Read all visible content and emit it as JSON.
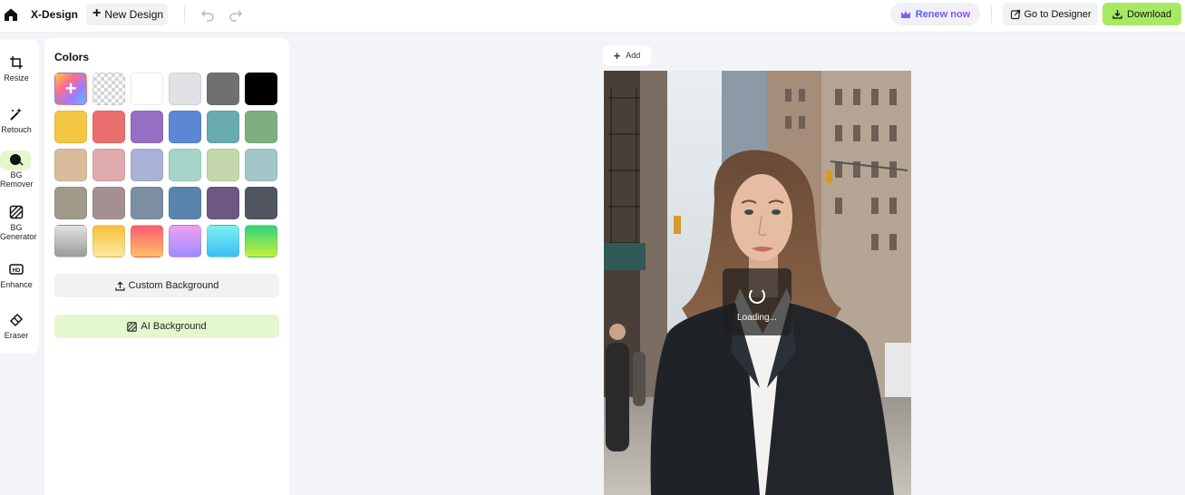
{
  "header": {
    "brand": "X-Design",
    "new_design_label": "New Design",
    "renew_label": "Renew now",
    "go_to_designer_label": "Go to Designer",
    "download_label": "Download"
  },
  "tools": [
    {
      "label_lines": [
        "Resize"
      ],
      "icon": "crop-icon"
    },
    {
      "label_lines": [
        "Retouch"
      ],
      "icon": "magic-wand-icon"
    },
    {
      "label_lines": [
        "BG",
        "Remover"
      ],
      "icon": "bg-remover-icon",
      "active": true
    },
    {
      "label_lines": [
        "BG",
        "Generator"
      ],
      "icon": "hatched-square-icon"
    },
    {
      "label_lines": [
        "Enhance"
      ],
      "icon": "hd-icon"
    },
    {
      "label_lines": [
        "Eraser"
      ],
      "icon": "eraser-icon"
    }
  ],
  "colors_panel": {
    "title": "Colors",
    "swatches": [
      [
        "add-color",
        "transparent",
        "#ffffff",
        "#e1e2e5",
        "#707070",
        "#000000"
      ],
      [
        "#f3c644",
        "#ea6f6e",
        "#946fc3",
        "#5b88d5",
        "#68abb0",
        "#7fae7f"
      ],
      [
        "#d8bc9b",
        "#dfabad",
        "#aab1d7",
        "#a6d4c9",
        "#c5d8ad",
        "#a5c6c9"
      ],
      [
        "#a09a8a",
        "#a49090",
        "#7c8ea2",
        "#5783ac",
        "#6d5783",
        "#515660"
      ],
      [
        "linear-gradient(#e2e2e2,#9b9b9b)",
        "linear-gradient(#f6c03a,#fbe8a4)",
        "linear-gradient(#ff5c6e,#ffc069)",
        "linear-gradient(#f0a0f0,#9b8cff)",
        "linear-gradient(#7ff0f0,#3cbef5)",
        "linear-gradient(#2fd37a,#c6ef3c)"
      ]
    ],
    "custom_background_label": "Custom Background",
    "ai_background_label": "AI Background"
  },
  "canvas": {
    "add_label": "Add",
    "loading_text": "Loading..."
  },
  "colors": {
    "accent_green": "#a6ea63",
    "active_tool_bg": "#e4f8cf",
    "renew_gradient": [
      "#4f62f0",
      "#9b4cf0"
    ]
  }
}
